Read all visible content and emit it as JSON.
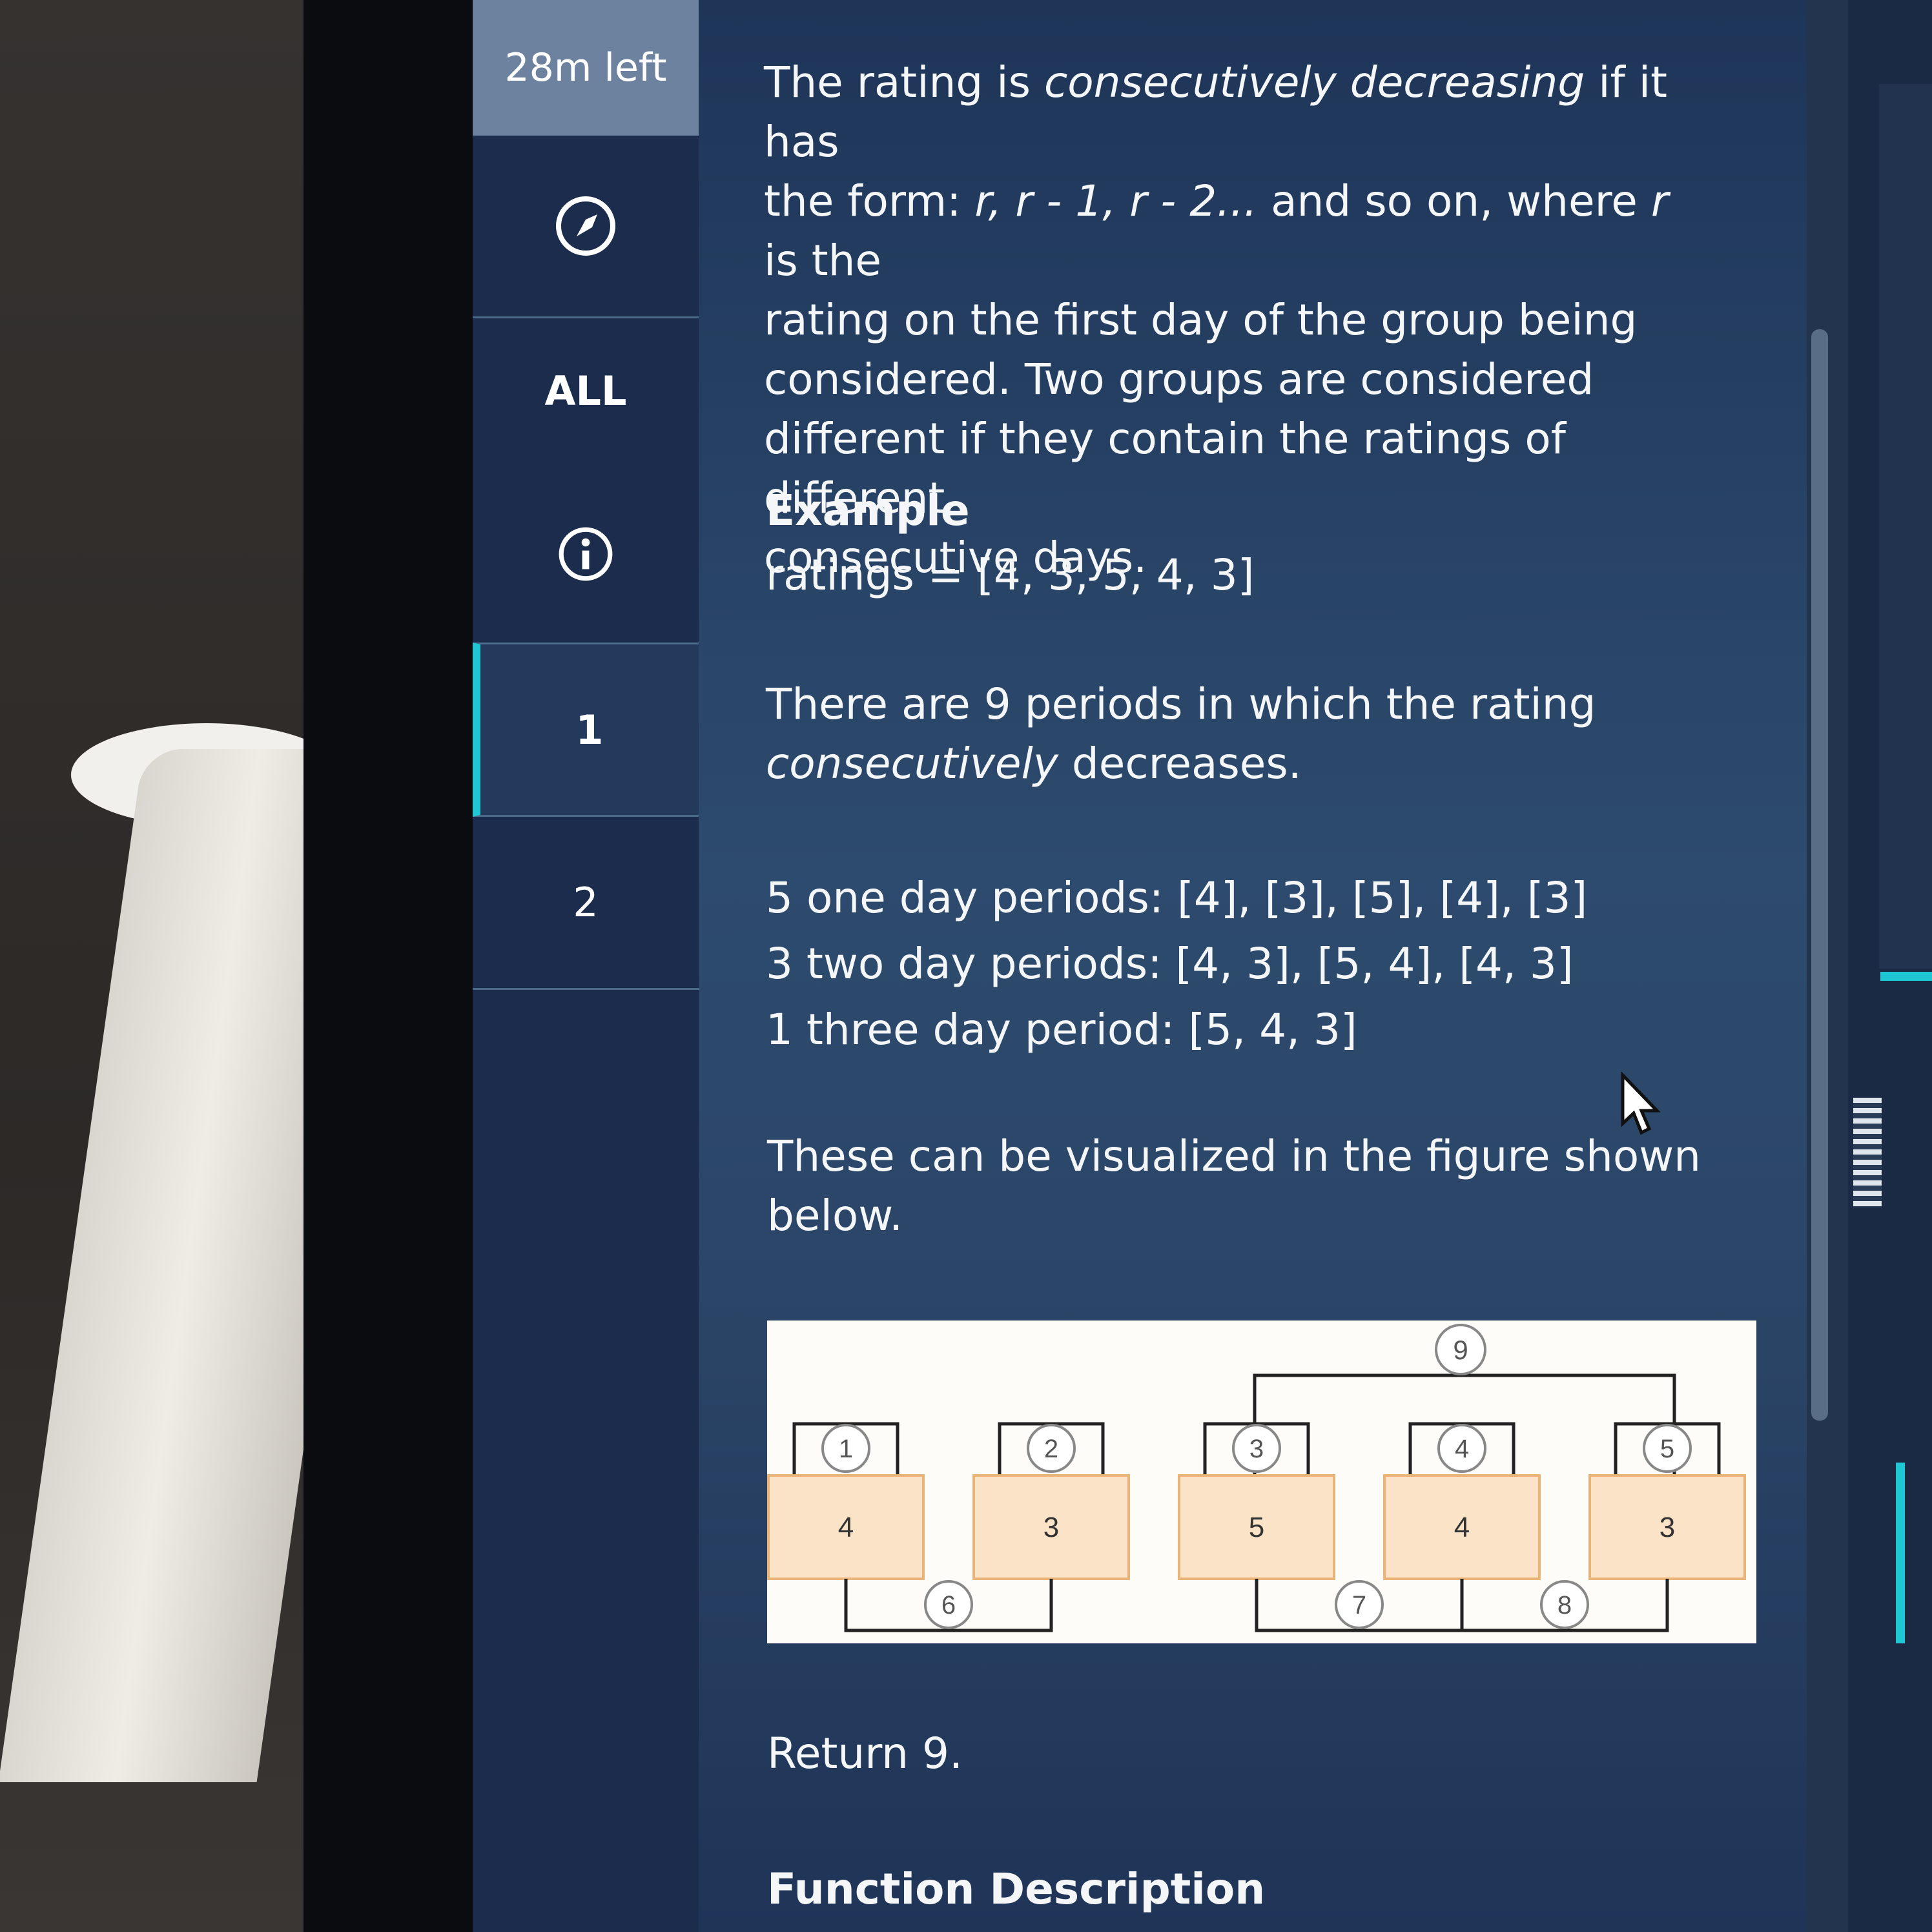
{
  "timer": {
    "label": "28m left"
  },
  "sidebar": {
    "items": [
      {
        "kind": "icon",
        "icon": "compass-icon"
      },
      {
        "kind": "text",
        "label": "ALL"
      },
      {
        "kind": "icon",
        "icon": "info-icon"
      },
      {
        "kind": "text",
        "label": "1",
        "active": true
      },
      {
        "kind": "text",
        "label": "2"
      }
    ]
  },
  "problem": {
    "p1_a": "The rating is ",
    "p1_em": "consecutively decreasing",
    "p1_b": " if it has",
    "p1_line2_a": "the form: ",
    "p1_line2_em": "r, r - 1, r - 2...",
    "p1_line2_b": " and so on, where ",
    "p1_line2_em2": "r",
    "p1_line2_c": " is the",
    "p1_line3": "rating on the first day of the group being",
    "p1_line4": "considered. Two groups are considered",
    "p1_line5": "different if they contain the ratings of different",
    "p1_line6": "consecutive days.",
    "example_heading": "Example",
    "example_ratings": "ratings = [4, 3, 5, 4, 3]",
    "periods_line1": "There are 9 periods in which the rating",
    "periods_em": "consecutively",
    "periods_line2_b": " decreases.",
    "one_day": "5 one day periods: [4], [3], [5], [4], [3]",
    "two_day": "3 two day periods: [4, 3], [5, 4], [4, 3]",
    "three_day": "1 three day period: [5, 4, 3]",
    "visual_line1": "These can be visualized in the figure shown",
    "visual_line2": "below.",
    "return": "Return 9.",
    "function_heading": "Function Description"
  },
  "figure": {
    "ratings": [
      "4",
      "3",
      "5",
      "4",
      "3"
    ],
    "top_labels": [
      "1",
      "2",
      "3",
      "4",
      "5"
    ],
    "pair_labels": [
      "6",
      "7",
      "8"
    ],
    "triple_label": "9"
  },
  "colors": {
    "accent": "#21c6d3",
    "box_fill": "#fbe3c8",
    "box_stroke": "#e8b47a"
  }
}
